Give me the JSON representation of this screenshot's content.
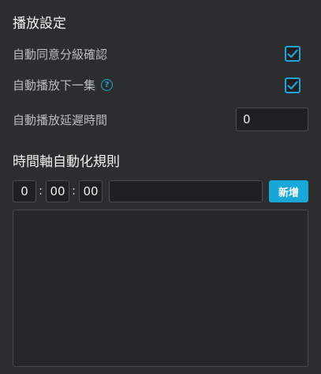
{
  "playback": {
    "title": "播放設定",
    "auto_consent_label": "自動同意分級確認",
    "auto_consent_checked": true,
    "auto_next_label": "自動播放下一集",
    "auto_next_checked": true,
    "auto_next_help_icon": "question-circle-icon",
    "delay_label": "自動播放延遲時間",
    "delay_value": "0"
  },
  "timeline_rules": {
    "title": "時間軸自動化規則",
    "hours_value": "0",
    "minutes_value": "00",
    "seconds_value": "00",
    "separator": ":",
    "rule_text_value": "",
    "add_button_label": "新增",
    "rules": []
  },
  "colors": {
    "accent": "#21a3d6",
    "button": "#19a7d8",
    "background": "#2c2d2f"
  }
}
